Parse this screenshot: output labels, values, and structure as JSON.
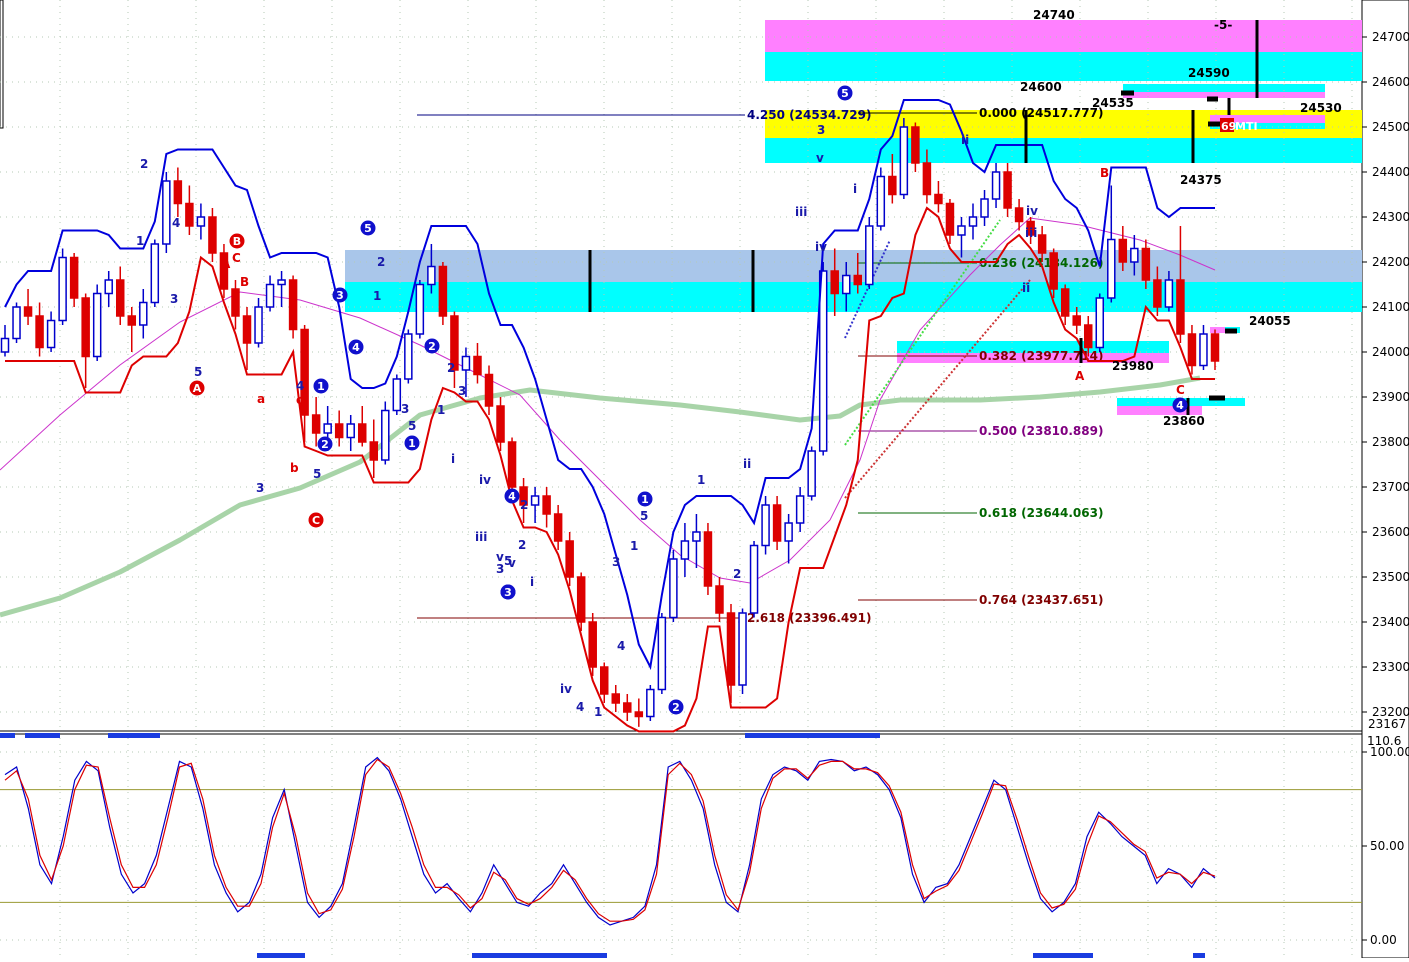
{
  "chart_data": {
    "type": "candlestick",
    "price_axis": {
      "range": [
        23167,
        24740
      ],
      "ticks": [
        24700,
        24600,
        24500,
        24400,
        24300,
        24200,
        24100,
        24000,
        23900,
        23800,
        23700,
        23600,
        23500,
        23400,
        23300,
        23200
      ],
      "tick_labels": [
        "24700.",
        "24600.",
        "24500.",
        "24400.",
        "24300.",
        "24200.",
        "24100.",
        "24000.",
        "23900.",
        "23800.",
        "23700.",
        "23600.",
        "23500.",
        "23400.",
        "23300.",
        "23200."
      ],
      "last_label": "23167"
    },
    "oscillator_axis": {
      "range": [
        0,
        110
      ],
      "ticks": [
        100,
        50,
        0
      ],
      "tick_labels": [
        "100.00",
        "50.00",
        "0.00"
      ],
      "top_label": "110.6"
    },
    "colors": {
      "upper_band": "#0000dd",
      "lower_band": "#dd0000",
      "slow_ma": "#a8d4a8",
      "mid_ma": "#cc33cc",
      "zone_cyan": "#00ffff",
      "zone_magenta": "#ff80ff",
      "zone_yellow": "#ffff00",
      "zone_blue": "#a9c6ea",
      "bull_candle": "#0000cc",
      "bear_candle": "#dd0000",
      "neutral_candle": "#000000"
    },
    "fib_levels": [
      {
        "label": "4.250 (24534.729)",
        "price": 24534.729,
        "color": "#000080"
      },
      {
        "label": "0.000 (24517.777)",
        "price": 24517.777,
        "color": "#000000"
      },
      {
        "label": "0.236 (24184.126)",
        "price": 24184.126,
        "color": "#006600"
      },
      {
        "label": "0.382 (23977.714)",
        "price": 23977.714,
        "color": "#800000"
      },
      {
        "label": "0.500 (23810.889)",
        "price": 23810.889,
        "color": "#800080"
      },
      {
        "label": "0.618 (23644.063)",
        "price": 23644.063,
        "color": "#006600"
      },
      {
        "label": "2.618 (23396.491)",
        "price": 23396.491,
        "color": "#800000"
      },
      {
        "label": "0.764 (23437.651)",
        "price": 23437.651,
        "color": "#800000"
      }
    ],
    "level_labels": [
      "24740",
      "24600",
      "24590",
      "24535",
      "24530",
      "24375",
      "24055",
      "23980",
      "23860"
    ],
    "markers": [
      "-5-",
      "69",
      "MTI"
    ],
    "wave_labels_plain": [
      "2",
      "4",
      "1",
      "3",
      "5",
      "A",
      "C",
      "B",
      "4",
      "c",
      "a",
      "b",
      "3",
      "5",
      "2",
      "1",
      "3",
      "5",
      "1",
      "2",
      "3",
      "i",
      "iv",
      "iii",
      "v",
      "3",
      "v",
      "5",
      "2",
      "i",
      "iv",
      "4",
      "1",
      "2",
      "1",
      "5",
      "3",
      "4",
      "1",
      "ii",
      "2",
      "3",
      "i",
      "v",
      "iii",
      "iv",
      "ii",
      "iii",
      "iv",
      "ii",
      "B",
      "A",
      "C"
    ],
    "wave_labels_circled": [
      "A",
      "B",
      "C",
      "1",
      "2",
      "3",
      "4",
      "5",
      "1",
      "2",
      "3",
      "4",
      "5",
      "1",
      "2",
      "3",
      "4"
    ],
    "candles": [
      {
        "o": 24000,
        "h": 24060,
        "l": 23990,
        "c": 24030
      },
      {
        "o": 24030,
        "h": 24110,
        "l": 24020,
        "c": 24100
      },
      {
        "o": 24100,
        "h": 24140,
        "l": 24060,
        "c": 24080
      },
      {
        "o": 24080,
        "h": 24110,
        "l": 23990,
        "c": 24010
      },
      {
        "o": 24010,
        "h": 24090,
        "l": 24000,
        "c": 24070
      },
      {
        "o": 24070,
        "h": 24230,
        "l": 24060,
        "c": 24210
      },
      {
        "o": 24210,
        "h": 24220,
        "l": 24100,
        "c": 24120
      },
      {
        "o": 24120,
        "h": 24130,
        "l": 23920,
        "c": 23990
      },
      {
        "o": 23990,
        "h": 24150,
        "l": 23980,
        "c": 24130
      },
      {
        "o": 24130,
        "h": 24180,
        "l": 24100,
        "c": 24160
      },
      {
        "o": 24160,
        "h": 24190,
        "l": 24060,
        "c": 24080
      },
      {
        "o": 24080,
        "h": 24100,
        "l": 24000,
        "c": 24060
      },
      {
        "o": 24060,
        "h": 24140,
        "l": 24030,
        "c": 24110
      },
      {
        "o": 24110,
        "h": 24250,
        "l": 24100,
        "c": 24240
      },
      {
        "o": 24240,
        "h": 24400,
        "l": 24220,
        "c": 24380
      },
      {
        "o": 24380,
        "h": 24410,
        "l": 24300,
        "c": 24330
      },
      {
        "o": 24330,
        "h": 24370,
        "l": 24260,
        "c": 24280
      },
      {
        "o": 24280,
        "h": 24330,
        "l": 24250,
        "c": 24300
      },
      {
        "o": 24300,
        "h": 24320,
        "l": 24200,
        "c": 24220
      },
      {
        "o": 24220,
        "h": 24240,
        "l": 24120,
        "c": 24140
      },
      {
        "o": 24140,
        "h": 24160,
        "l": 24050,
        "c": 24080
      },
      {
        "o": 24080,
        "h": 24100,
        "l": 23960,
        "c": 24020
      },
      {
        "o": 24020,
        "h": 24120,
        "l": 24010,
        "c": 24100
      },
      {
        "o": 24100,
        "h": 24170,
        "l": 24090,
        "c": 24150
      },
      {
        "o": 24150,
        "h": 24180,
        "l": 24100,
        "c": 24160
      },
      {
        "o": 24160,
        "h": 24170,
        "l": 24030,
        "c": 24050
      },
      {
        "o": 24050,
        "h": 24060,
        "l": 23800,
        "c": 23860
      },
      {
        "o": 23860,
        "h": 23900,
        "l": 23790,
        "c": 23820
      },
      {
        "o": 23820,
        "h": 23880,
        "l": 23780,
        "c": 23840
      },
      {
        "o": 23840,
        "h": 23870,
        "l": 23790,
        "c": 23810
      },
      {
        "o": 23810,
        "h": 23860,
        "l": 23780,
        "c": 23840
      },
      {
        "o": 23840,
        "h": 23880,
        "l": 23790,
        "c": 23800
      },
      {
        "o": 23800,
        "h": 23850,
        "l": 23720,
        "c": 23760
      },
      {
        "o": 23760,
        "h": 23890,
        "l": 23750,
        "c": 23870
      },
      {
        "o": 23870,
        "h": 23950,
        "l": 23860,
        "c": 23940
      },
      {
        "o": 23940,
        "h": 24050,
        "l": 23930,
        "c": 24040
      },
      {
        "o": 24040,
        "h": 24160,
        "l": 24030,
        "c": 24150
      },
      {
        "o": 24150,
        "h": 24240,
        "l": 24130,
        "c": 24190
      },
      {
        "o": 24190,
        "h": 24200,
        "l": 24060,
        "c": 24080
      },
      {
        "o": 24080,
        "h": 24090,
        "l": 23920,
        "c": 23960
      },
      {
        "o": 23960,
        "h": 24010,
        "l": 23900,
        "c": 23990
      },
      {
        "o": 23990,
        "h": 24020,
        "l": 23930,
        "c": 23950
      },
      {
        "o": 23950,
        "h": 23970,
        "l": 23860,
        "c": 23880
      },
      {
        "o": 23880,
        "h": 23900,
        "l": 23780,
        "c": 23800
      },
      {
        "o": 23800,
        "h": 23810,
        "l": 23680,
        "c": 23700
      },
      {
        "o": 23700,
        "h": 23720,
        "l": 23620,
        "c": 23660
      },
      {
        "o": 23660,
        "h": 23700,
        "l": 23620,
        "c": 23680
      },
      {
        "o": 23680,
        "h": 23700,
        "l": 23610,
        "c": 23640
      },
      {
        "o": 23640,
        "h": 23660,
        "l": 23560,
        "c": 23580
      },
      {
        "o": 23580,
        "h": 23600,
        "l": 23480,
        "c": 23500
      },
      {
        "o": 23500,
        "h": 23510,
        "l": 23380,
        "c": 23400
      },
      {
        "o": 23400,
        "h": 23420,
        "l": 23280,
        "c": 23300
      },
      {
        "o": 23300,
        "h": 23310,
        "l": 23220,
        "c": 23240
      },
      {
        "o": 23240,
        "h": 23260,
        "l": 23200,
        "c": 23220
      },
      {
        "o": 23220,
        "h": 23240,
        "l": 23180,
        "c": 23200
      },
      {
        "o": 23200,
        "h": 23230,
        "l": 23167,
        "c": 23190
      },
      {
        "o": 23190,
        "h": 23260,
        "l": 23180,
        "c": 23250
      },
      {
        "o": 23250,
        "h": 23420,
        "l": 23240,
        "c": 23410
      },
      {
        "o": 23410,
        "h": 23560,
        "l": 23400,
        "c": 23540
      },
      {
        "o": 23540,
        "h": 23620,
        "l": 23500,
        "c": 23580
      },
      {
        "o": 23580,
        "h": 23640,
        "l": 23520,
        "c": 23600
      },
      {
        "o": 23600,
        "h": 23620,
        "l": 23460,
        "c": 23480
      },
      {
        "o": 23480,
        "h": 23500,
        "l": 23400,
        "c": 23420
      },
      {
        "o": 23420,
        "h": 23440,
        "l": 23220,
        "c": 23260
      },
      {
        "o": 23260,
        "h": 23430,
        "l": 23240,
        "c": 23420
      },
      {
        "o": 23420,
        "h": 23580,
        "l": 23410,
        "c": 23570
      },
      {
        "o": 23570,
        "h": 23680,
        "l": 23550,
        "c": 23660
      },
      {
        "o": 23660,
        "h": 23680,
        "l": 23560,
        "c": 23580
      },
      {
        "o": 23580,
        "h": 23640,
        "l": 23530,
        "c": 23620
      },
      {
        "o": 23620,
        "h": 23700,
        "l": 23600,
        "c": 23680
      },
      {
        "o": 23680,
        "h": 23790,
        "l": 23670,
        "c": 23780
      },
      {
        "o": 23780,
        "h": 24200,
        "l": 23770,
        "c": 24180
      },
      {
        "o": 24180,
        "h": 24230,
        "l": 24080,
        "c": 24130
      },
      {
        "o": 24130,
        "h": 24200,
        "l": 24090,
        "c": 24170
      },
      {
        "o": 24170,
        "h": 24220,
        "l": 24130,
        "c": 24150
      },
      {
        "o": 24150,
        "h": 24300,
        "l": 24140,
        "c": 24280
      },
      {
        "o": 24280,
        "h": 24410,
        "l": 24270,
        "c": 24390
      },
      {
        "o": 24390,
        "h": 24440,
        "l": 24330,
        "c": 24350
      },
      {
        "o": 24350,
        "h": 24520,
        "l": 24340,
        "c": 24500
      },
      {
        "o": 24500,
        "h": 24510,
        "l": 24400,
        "c": 24420
      },
      {
        "o": 24420,
        "h": 24450,
        "l": 24330,
        "c": 24350
      },
      {
        "o": 24350,
        "h": 24380,
        "l": 24310,
        "c": 24330
      },
      {
        "o": 24330,
        "h": 24340,
        "l": 24240,
        "c": 24260
      },
      {
        "o": 24260,
        "h": 24300,
        "l": 24210,
        "c": 24280
      },
      {
        "o": 24280,
        "h": 24330,
        "l": 24250,
        "c": 24300
      },
      {
        "o": 24300,
        "h": 24360,
        "l": 24280,
        "c": 24340
      },
      {
        "o": 24340,
        "h": 24420,
        "l": 24320,
        "c": 24400
      },
      {
        "o": 24400,
        "h": 24420,
        "l": 24300,
        "c": 24320
      },
      {
        "o": 24320,
        "h": 24340,
        "l": 24270,
        "c": 24290
      },
      {
        "o": 24290,
        "h": 24300,
        "l": 24240,
        "c": 24260
      },
      {
        "o": 24260,
        "h": 24280,
        "l": 24200,
        "c": 24220
      },
      {
        "o": 24220,
        "h": 24230,
        "l": 24120,
        "c": 24140
      },
      {
        "o": 24140,
        "h": 24150,
        "l": 24060,
        "c": 24080
      },
      {
        "o": 24080,
        "h": 24100,
        "l": 24040,
        "c": 24060
      },
      {
        "o": 24060,
        "h": 24080,
        "l": 23990,
        "c": 24010
      },
      {
        "o": 24010,
        "h": 24130,
        "l": 24000,
        "c": 24120
      },
      {
        "o": 24120,
        "h": 24370,
        "l": 24110,
        "c": 24250
      },
      {
        "o": 24250,
        "h": 24280,
        "l": 24180,
        "c": 24200
      },
      {
        "o": 24200,
        "h": 24260,
        "l": 24170,
        "c": 24230
      },
      {
        "o": 24230,
        "h": 24250,
        "l": 24140,
        "c": 24160
      },
      {
        "o": 24160,
        "h": 24190,
        "l": 24080,
        "c": 24100
      },
      {
        "o": 24100,
        "h": 24180,
        "l": 24090,
        "c": 24160
      },
      {
        "o": 24160,
        "h": 24280,
        "l": 24020,
        "c": 24040
      },
      {
        "o": 24040,
        "h": 24060,
        "l": 23950,
        "c": 23970
      },
      {
        "o": 23970,
        "h": 24060,
        "l": 23960,
        "c": 24040
      },
      {
        "o": 24040,
        "h": 24050,
        "l": 23960,
        "c": 23980
      }
    ],
    "oscillator_series": [
      {
        "name": "",
        "color": "#0000cc",
        "values": [
          88,
          92,
          70,
          40,
          30,
          55,
          85,
          95,
          90,
          60,
          35,
          25,
          30,
          45,
          70,
          95,
          92,
          70,
          40,
          25,
          15,
          20,
          35,
          65,
          80,
          50,
          20,
          12,
          18,
          30,
          60,
          92,
          97,
          90,
          75,
          55,
          35,
          25,
          30,
          22,
          15,
          25,
          40,
          30,
          20,
          18,
          25,
          30,
          40,
          30,
          20,
          12,
          8,
          10,
          12,
          18,
          40,
          92,
          95,
          85,
          70,
          40,
          20,
          15,
          40,
          75,
          88,
          92,
          90,
          85,
          95,
          96,
          95,
          90,
          92,
          88,
          80,
          65,
          35,
          20,
          28,
          30,
          40,
          55,
          70,
          85,
          80,
          60,
          40,
          22,
          15,
          20,
          30,
          55,
          68,
          62,
          55,
          50,
          45,
          30,
          38,
          35,
          28,
          38,
          33
        ]
      },
      {
        "name": "",
        "color": "#dd0000",
        "values": [
          85,
          90,
          75,
          45,
          32,
          50,
          80,
          93,
          92,
          65,
          40,
          28,
          28,
          40,
          65,
          92,
          94,
          75,
          45,
          28,
          18,
          18,
          30,
          60,
          78,
          55,
          25,
          14,
          16,
          27,
          55,
          88,
          96,
          92,
          78,
          60,
          40,
          28,
          28,
          24,
          17,
          22,
          36,
          32,
          22,
          19,
          22,
          28,
          37,
          32,
          22,
          14,
          10,
          10,
          11,
          16,
          35,
          88,
          94,
          88,
          74,
          45,
          24,
          16,
          36,
          70,
          86,
          91,
          91,
          86,
          93,
          95,
          95,
          91,
          91,
          89,
          82,
          68,
          40,
          22,
          26,
          29,
          37,
          52,
          67,
          83,
          82,
          64,
          44,
          25,
          17,
          19,
          27,
          50,
          66,
          63,
          57,
          51,
          47,
          33,
          36,
          35,
          30,
          36,
          34
        ]
      }
    ]
  }
}
